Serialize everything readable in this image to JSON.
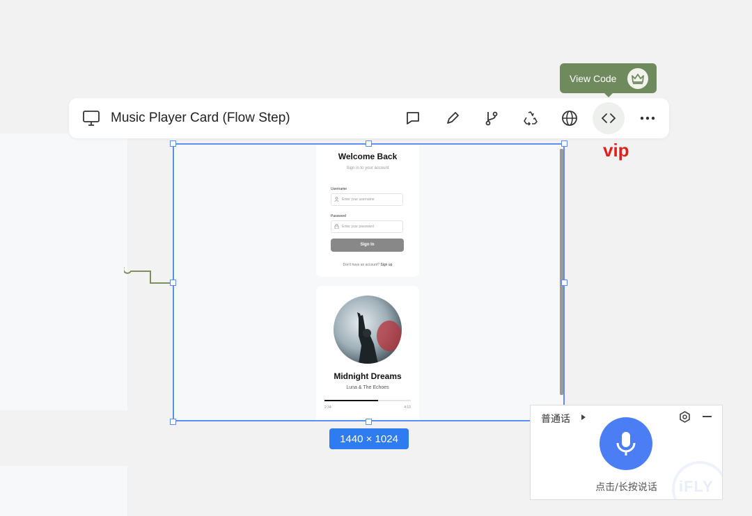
{
  "toolbar": {
    "title": "Music Player Card (Flow Step)",
    "icons": [
      "monitor-icon",
      "comment-icon",
      "pencil-icon",
      "branch-icon",
      "recycle-icon",
      "globe-icon",
      "code-icon",
      "more-icon"
    ]
  },
  "tooltip": {
    "label": "View Code",
    "icon": "crown-icon"
  },
  "vip_label": "vip",
  "frame_size": "1440 × 1024",
  "login": {
    "title": "Welcome Back",
    "subtitle": "Sign in to your account",
    "username_label": "Username",
    "username_placeholder": "Enter your username",
    "password_label": "Password",
    "password_placeholder": "Enter your password",
    "signin_label": "Sign In",
    "signup_prompt": "Don't have an account?",
    "signup_link": "Sign up"
  },
  "player": {
    "song": "Midnight Dreams",
    "artist": "Luna & The Echoes",
    "current_time": "2:34",
    "total_time": "4:12",
    "progress": 0.62
  },
  "voice": {
    "language": "普通话",
    "hint": "点击/长按说话",
    "logo": "iFLY"
  },
  "colors": {
    "accent": "#2f7bf0",
    "tooltip": "#6f8b5e",
    "vip": "#e0201b",
    "mic": "#4b7ef5"
  }
}
